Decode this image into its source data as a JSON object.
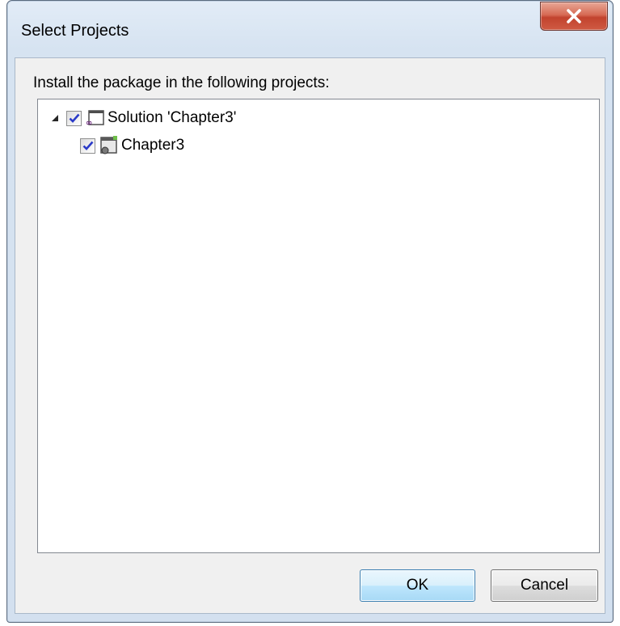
{
  "window": {
    "title": "Select Projects",
    "close_icon": "close-x-icon"
  },
  "dialog": {
    "instruction": "Install the package in the following projects:"
  },
  "tree": {
    "root": {
      "label": "Solution 'Chapter3'",
      "checked": true,
      "expanded": true,
      "icon": "visual-studio-solution-icon",
      "expander_icon": "expanded-triangle-icon"
    },
    "children": [
      {
        "label": "Chapter3",
        "checked": true,
        "icon": "project-icon"
      }
    ]
  },
  "buttons": {
    "ok_label": "OK",
    "cancel_label": "Cancel"
  },
  "colors": {
    "checkmark": "#2a3ac8",
    "vs_purple": "#68217a",
    "close_button": "#c7432f"
  }
}
